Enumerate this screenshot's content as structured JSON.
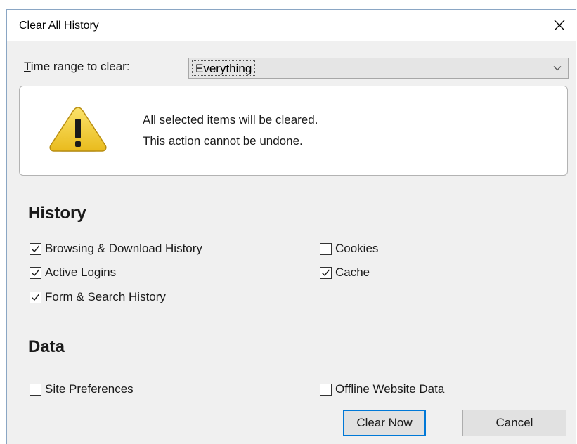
{
  "window": {
    "title": "Clear All History",
    "close_glyph": "✕"
  },
  "time_range": {
    "label_accesskey": "T",
    "label_rest": "ime range to clear:",
    "selected": "Everything",
    "arrow_icon": "chevron-down-icon"
  },
  "warning": {
    "icon": "warning-icon",
    "line1": "All selected items will be cleared.",
    "line2": "This action cannot be undone.",
    "icon_color": "#f5d442"
  },
  "history": {
    "heading": "History",
    "items": [
      {
        "label": "Browsing & Download History",
        "checked": true
      },
      {
        "label": "Active Logins",
        "checked": true
      },
      {
        "label": "Form & Search History",
        "checked": true
      },
      {
        "label": "Cookies",
        "checked": false
      },
      {
        "label": "Cache",
        "checked": true
      }
    ]
  },
  "data": {
    "heading": "Data",
    "items": [
      {
        "label": "Site Preferences",
        "checked": false
      },
      {
        "label": "Offline Website Data",
        "checked": false
      }
    ]
  },
  "buttons": {
    "clear_now": "Clear Now",
    "cancel": "Cancel"
  },
  "colors": {
    "accent": "#0078d7",
    "dialog_bg": "#f0f0f0",
    "border": "#8aa6c4"
  }
}
